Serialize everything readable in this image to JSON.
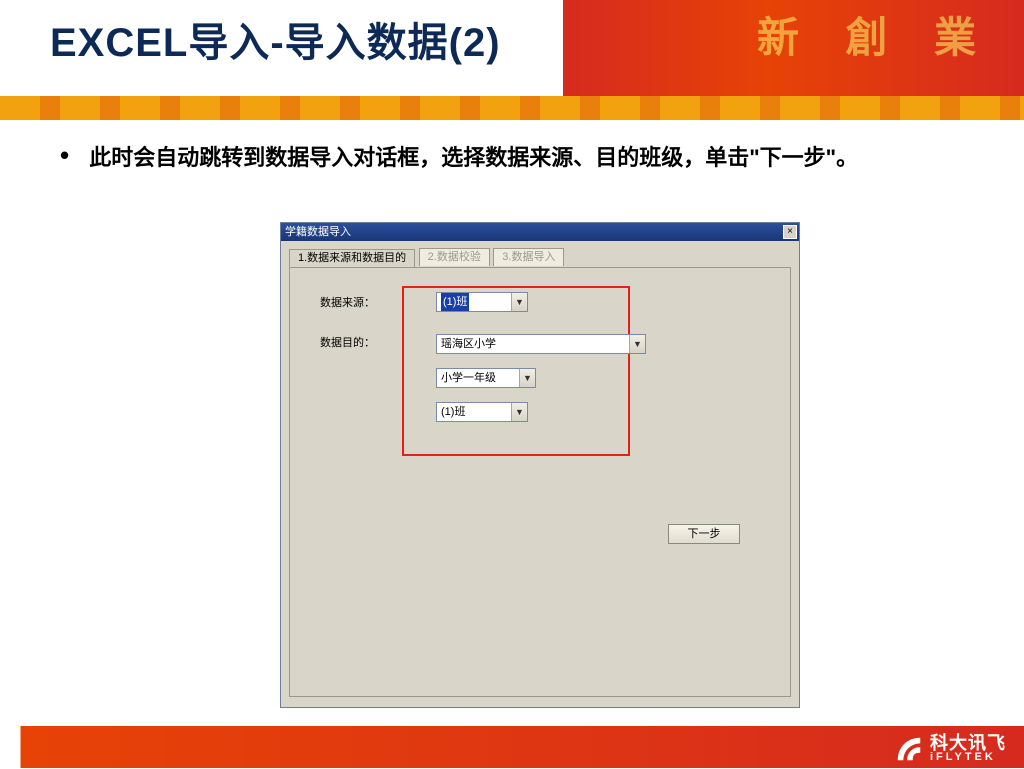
{
  "slide": {
    "title": "EXCEL导入-导入数据(2)",
    "bullet": "此时会自动跳转到数据导入对话框，选择数据来源、目的班级，单击\"下一步\"。",
    "decor": "新 創 業"
  },
  "dialog": {
    "title": "学籍数据导入",
    "close_glyph": "×",
    "tabs": {
      "t1": "1.数据来源和数据目的",
      "t2": "2.数据校验",
      "t3": "3.数据导入"
    },
    "labels": {
      "source": "数据来源：",
      "dest": "数据目的："
    },
    "source_value": "(1)班",
    "dest_school": "瑶海区小学",
    "dest_grade": "小学一年级",
    "dest_class": "(1)班",
    "arrow": "▼",
    "next": "下一步"
  },
  "brand": {
    "cn": "科大讯飞",
    "en": "iFLYTEK"
  }
}
